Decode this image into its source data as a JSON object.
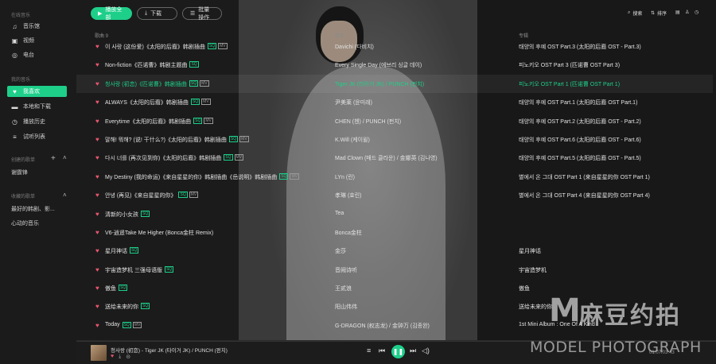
{
  "sidebar": {
    "section_online": "在线音乐",
    "online_items": [
      {
        "label": "音乐馆",
        "icon": "music-note-icon"
      },
      {
        "label": "视频",
        "icon": "video-icon"
      },
      {
        "label": "电台",
        "icon": "radio-icon"
      }
    ],
    "section_mine": "我的音乐",
    "mine_items": [
      {
        "label": "我喜欢",
        "icon": "heart-icon"
      },
      {
        "label": "本地和下载",
        "icon": "computer-icon"
      },
      {
        "label": "播放历史",
        "icon": "clock-icon"
      },
      {
        "label": "试听列表",
        "icon": "playlist-icon"
      }
    ],
    "section_created": "创建的歌单",
    "created_items": [
      "谢霆锋"
    ],
    "section_collected": "收藏的歌单",
    "collected_items": [
      "最好的韩剧、影...",
      "心动的音乐"
    ]
  },
  "toolbar": {
    "play_all": "播放全部",
    "download": "下载",
    "batch": "批量操作",
    "search": "搜索",
    "sort": "排序"
  },
  "columns": {
    "title": "歌曲 9",
    "artist": "歌手",
    "album": "专辑"
  },
  "songs": [
    {
      "title": "이 사랑 (这份爱)《太阳的后裔》韩剧插曲",
      "tags": [
        "SQ",
        "MV"
      ],
      "artist": "Davichi (다비치)",
      "album": "태양의 후예 OST Part.3 (太阳的后裔 OST - Part.3)"
    },
    {
      "title": "Non-fiction《匹诺曹》韩剧主题曲",
      "tags": [
        "SQ"
      ],
      "artist": "Every Single Day (에브리 싱글 데이)",
      "album": "피노키오 OST Part 3 (匹诺曹 OST Part 3)"
    },
    {
      "title": "청사랑 (初恋)《匹诺曹》韩剧插曲",
      "tags": [
        "SQ",
        "MV"
      ],
      "artist": "Tiger JK (타이거 JK) / PUNCH (펀치)",
      "album": "피노키오 OST Part 1 (匹诺曹 OST Part 1)"
    },
    {
      "title": "ALWAYS《太阳的后裔》韩剧插曲",
      "tags": [
        "SQ",
        "MV"
      ],
      "artist": "尹美莱 (윤미래)",
      "album": "태양의 후예 OST Part.1 (太阳的后裔 OST Part.1)"
    },
    {
      "title": "Everytime《太阳的后裔》韩剧插曲",
      "tags": [
        "SQ",
        "MV"
      ],
      "artist": "CHEN (첸) / PUNCH (펀치)",
      "album": "태양의 후예 OST Part.2 (太阳的后裔 OST - Part.2)"
    },
    {
      "title": "말해! 뭐해? (说! 干什么?)《太阳的后裔》韩剧插曲",
      "tags": [
        "SQ",
        "MV"
      ],
      "artist": "K.Will (케이윌)",
      "album": "태양의 후예 OST Part.6 (太阳的后裔 OST - Part.6)"
    },
    {
      "title": "다시 너를 (再次见到你)《太阳的后裔》韩剧插曲",
      "tags": [
        "SQ",
        "MV"
      ],
      "artist": "Mad Clown (매드 클라운) / 金娜英 (김나영)",
      "album": "태양의 후예 OST Part.5 (太阳的后裔 OST - Part.5)"
    },
    {
      "title": "My Destiny (我的命运)《来自星星的你》韩剧插曲《岳说明》韩剧插曲",
      "tags": [
        "SQ",
        "MV"
      ],
      "artist": "LYn (린)",
      "album": "별에서 온 그대 OST Part 1 (来自星星的你 OST Part 1)"
    },
    {
      "title": "안녕 (再见)《来自星星的你》",
      "tags": [
        "SQ",
        "MV"
      ],
      "artist": "孝琳 (효린)",
      "album": "별에서 온 그대 OST Part 4 (来自星星的你 OST Part 4)"
    },
    {
      "title": "清新的小女孩",
      "tags": [
        "SQ"
      ],
      "artist": "Tea",
      "album": ""
    },
    {
      "title": "V6-逍遥Take Me Higher (Bonca金柱 Remix)",
      "tags": [],
      "artist": "Bonca金柱",
      "album": ""
    },
    {
      "title": "星月神话",
      "tags": [
        "SQ"
      ],
      "artist": "金莎",
      "album": "星月神话"
    },
    {
      "title": "宇宙造梦机 三强母语版",
      "tags": [
        "SQ"
      ],
      "artist": "音阙诗听",
      "album": "宇宙造梦机"
    },
    {
      "title": "傲鱼",
      "tags": [
        "SQ"
      ],
      "artist": "王贰浪",
      "album": "傲鱼"
    },
    {
      "title": "送给未来的你",
      "tags": [
        "SQ"
      ],
      "artist": "阳山伟伟",
      "album": "送给未来的你"
    },
    {
      "title": "Today",
      "tags": [
        "SQ",
        "MV"
      ],
      "artist": "G-DRAGON (权志龙) / 金钟万 (김종완)",
      "album": "1st Mini Album : One Of A Kind"
    }
  ],
  "player": {
    "now_playing": "청사랑 (初恋) - Tiger JK (타이거 JK) / PUNCH (펀치)",
    "time": "01:07/03:43"
  },
  "watermark": {
    "logo": "M",
    "cn": "麻豆约拍",
    "en": "MODEL PHOTOGRAPH"
  },
  "colors": {
    "accent": "#1ecf8a",
    "heart": "#e8556d"
  }
}
